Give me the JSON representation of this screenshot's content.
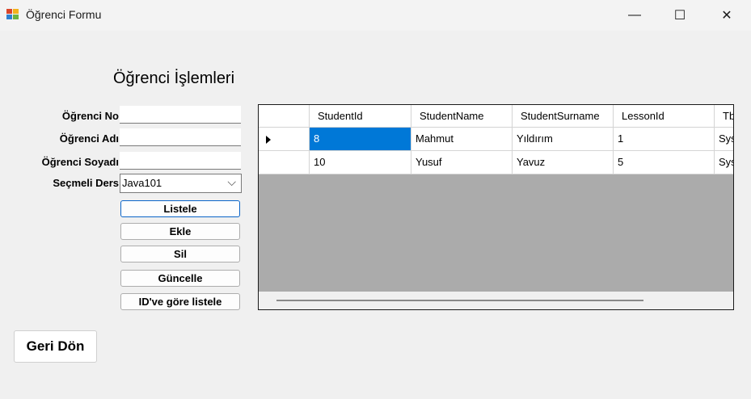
{
  "window": {
    "title": "Öğrenci Formu",
    "minimize_glyph": "—",
    "maximize_glyph": "☐",
    "close_glyph": "✕"
  },
  "form": {
    "heading": "Öğrenci İşlemleri",
    "labels": {
      "no": "Öğrenci No",
      "ad": "Öğrenci Adı",
      "soyad": "Öğrenci Soyadı",
      "ders": "Seçmeli Ders"
    },
    "inputs": {
      "no": "",
      "ad": "",
      "soyad": ""
    },
    "combo": {
      "value": "Java101",
      "chevron": "⌵"
    },
    "buttons": {
      "listele": "Listele",
      "ekle": "Ekle",
      "sil": "Sil",
      "guncelle": "Güncelle",
      "id_listele": "ID've göre listele"
    },
    "back": "Geri Dön"
  },
  "grid": {
    "columns": [
      "StudentId",
      "StudentName",
      "StudentSurname",
      "LessonId",
      "Tb"
    ],
    "rows": [
      [
        "8",
        "Mahmut",
        "Yıldırım",
        "1",
        "Sys"
      ],
      [
        "10",
        "Yusuf",
        "Yavuz",
        "5",
        "Sys"
      ]
    ],
    "selected_row": 0,
    "selected_col": 0
  }
}
